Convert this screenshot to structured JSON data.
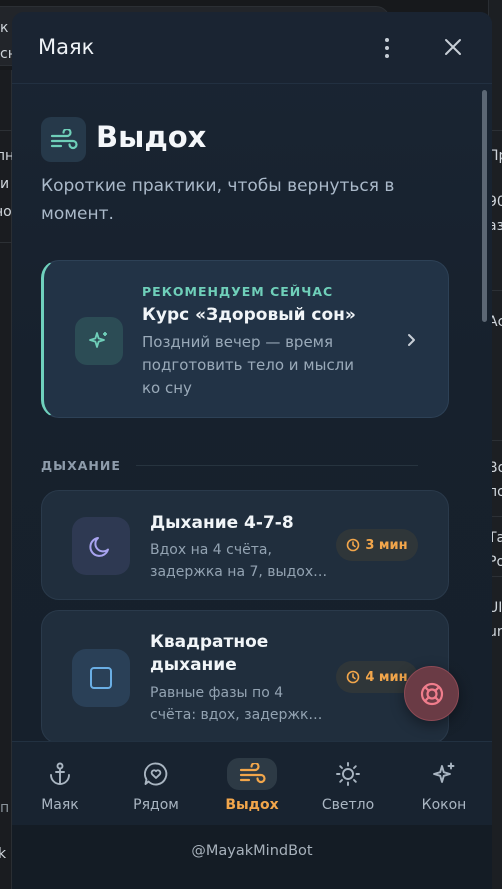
{
  "header": {
    "title": "Маяк"
  },
  "section": {
    "title": "Выдох",
    "subtitle": "Короткие практики, чтобы вернуться в момент."
  },
  "recommendation": {
    "label": "РЕКОМЕНДУЕМ СЕЙЧАС",
    "title": "Курс «Здоровый сон»",
    "description": "Поздний вечер — время подготовить тело и мысли ко сну"
  },
  "group": {
    "label": "ДЫХАНИЕ"
  },
  "practices": [
    {
      "title": "Дыхание 4-7-8",
      "description": "Вдох на 4 счёта, задержка на 7, выдох…",
      "duration": "3 мин",
      "icon": "moon-icon"
    },
    {
      "title": "Квадратное дыхание",
      "description": "Равные фазы по 4 счёта: вдох, задержк…",
      "duration": "4 мин",
      "icon": "square-icon"
    }
  ],
  "tabs": [
    {
      "label": "Маяк",
      "icon": "anchor-icon",
      "active": false
    },
    {
      "label": "Рядом",
      "icon": "heart-chat-icon",
      "active": false
    },
    {
      "label": "Выдох",
      "icon": "wind-icon",
      "active": true
    },
    {
      "label": "Светло",
      "icon": "sun-icon",
      "active": false
    },
    {
      "label": "Кокон",
      "icon": "sparkles-icon",
      "active": false
    }
  ],
  "footer": {
    "bot": "@MayakMindBot"
  },
  "background": {
    "fragments": [
      "к",
      "сн",
      "лн",
      "и",
      "но",
      "Пр",
      "90",
      "аз",
      "Ас",
      "Во",
      "по",
      "Та",
      "Ро",
      "UI",
      "ur",
      "п",
      "k ·"
    ]
  },
  "colors": {
    "accent": "#f2a64b",
    "teal": "#6fcfb9",
    "sos": "#6a3b45"
  }
}
